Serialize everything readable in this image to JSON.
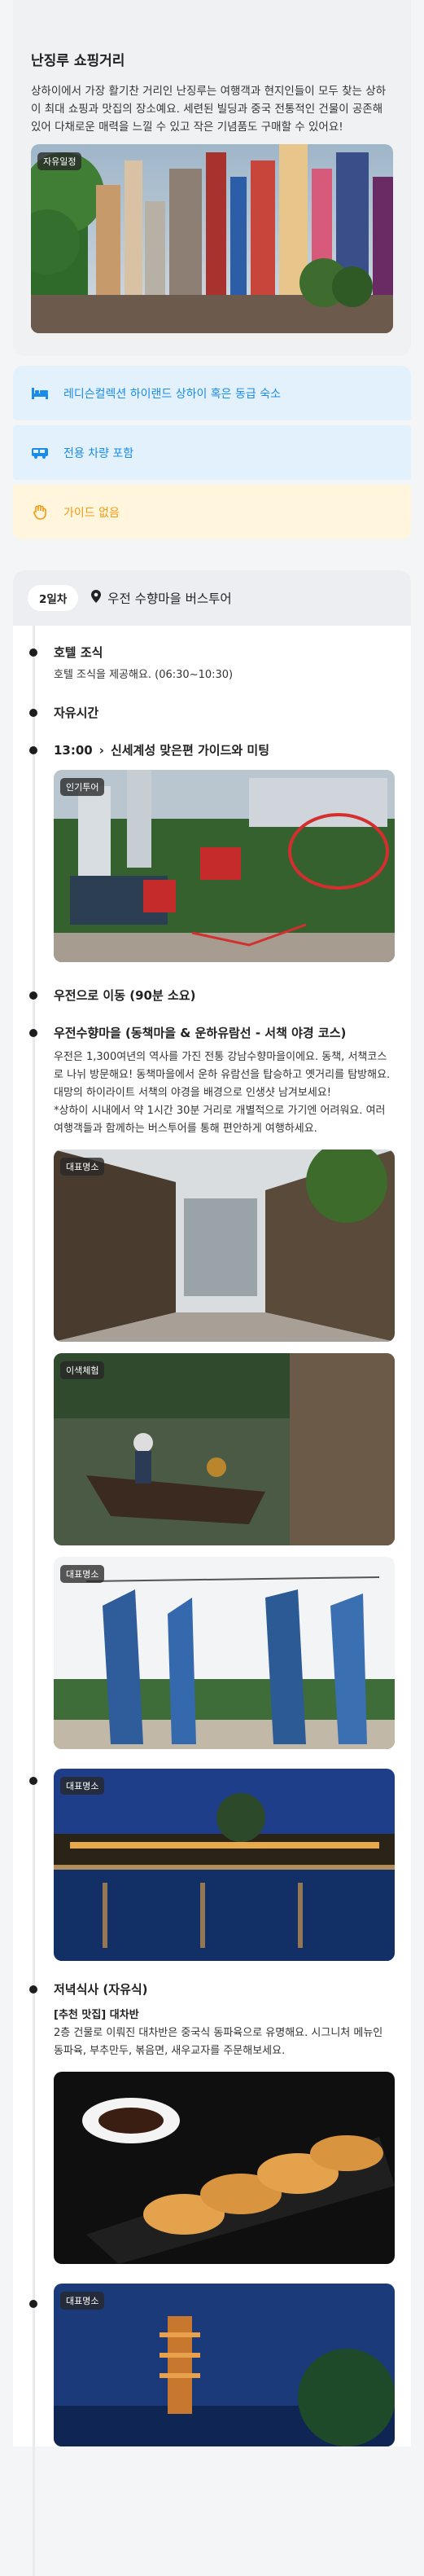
{
  "spot": {
    "title": "난징루 쇼핑거리",
    "description": "상하이에서 가장 활기찬 거리인 난징루는 여행객과 현지인들이 모두 찾는 상하이 최대 쇼핑과 맛집의 장소예요. 세련된 빌딩과 중국 전통적인 건물이 공존해 있어 다채로운 매력을 느낄 수 있고 작은 기념품도 구매할 수 있어요!",
    "photo_tag": "자유일정"
  },
  "info": {
    "hotel": "레디슨컬렉션 하이랜드 상하이 혹은 동급 숙소",
    "car": "전용 차량 포함",
    "guide": "가이드 없음"
  },
  "day2": {
    "pill": "2일차",
    "title": "우전 수향마을 버스투어",
    "items": {
      "breakfast_title": "호텔 조식",
      "breakfast_sub": "호텔 조식을 제공해요. (06:30~10:30)",
      "free_time": "자유시간",
      "meet_time": "13:00",
      "meet_text": "신세계성 맞은편 가이드와 미팅",
      "meet_tag": "인기투어",
      "move": "우전으로 이동 (90분 소요)",
      "village_title": "우전수향마을 (동책마을 & 운하유람선 - 서책 야경 코스)",
      "village_desc": "우전은 1,300여년의 역사를 가진 전통 강남수향마을이에요. 동책, 서책코스로 나뉘 방문해요! 동책마을에서 운하 유람선을 탑승하고 옛거리를 탐방해요. 대망의 하이라이트 서책의 야경을 배경으로 인생샷 남겨보세요!",
      "village_note": "*상하이 시내에서 약 1시간 30분 거리로 개별적으로 가기엔 어려워요. 여러 여행객들과 함께하는 버스투어를 통해 편안하게 여행하세요.",
      "tag_landmark1": "대표명소",
      "tag_experience": "이색체험",
      "tag_landmark2": "대표명소",
      "tag_landmark3": "대표명소",
      "dinner_title": "저녁식사 (자유식)",
      "dinner_recommend": "[추천 맛집] 대차반",
      "dinner_desc": "2층 건물로 이뤄진 대차반은 중국식 동파육으로 유명해요. 시그니처 메뉴인 동파육, 부추만두, 볶음면, 새우교자를 주문해보세요.",
      "tag_landmark4": "대표명소"
    }
  },
  "colors": {
    "blue": "#1a8be8",
    "orange": "#f39a13"
  }
}
